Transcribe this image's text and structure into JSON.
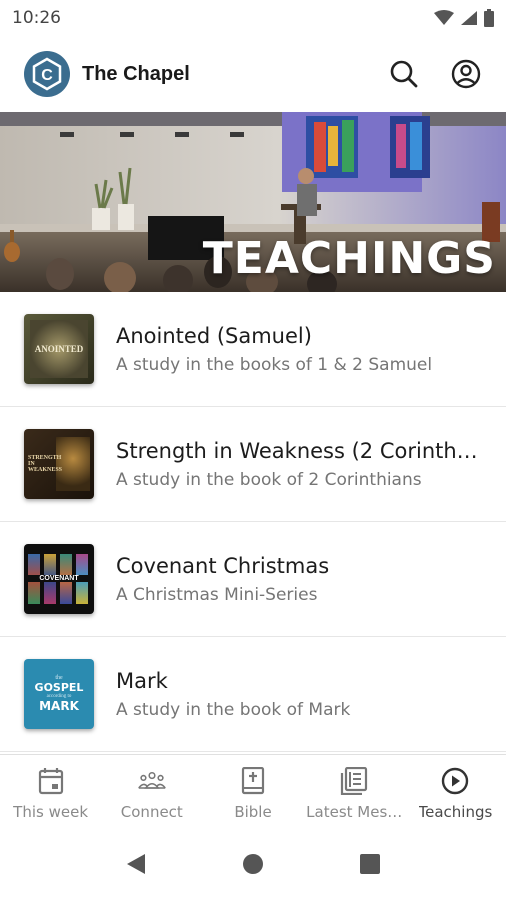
{
  "status": {
    "time": "10:26"
  },
  "app": {
    "title": "The Chapel",
    "logo_letter": "C"
  },
  "hero": {
    "title": "TEACHINGS"
  },
  "items": [
    {
      "title": "Anointed (Samuel)",
      "subtitle": "A study in the books of 1 & 2 Samuel",
      "thumb_text": "ANOINTED"
    },
    {
      "title": "Strength in Weakness (2 Corinthi…",
      "subtitle": "A study in the book of 2 Corinthians",
      "thumb_text": "STRENGTH IN WEAKNESS"
    },
    {
      "title": "Covenant Christmas",
      "subtitle": "A Christmas Mini-Series",
      "thumb_text": "COVENANT"
    },
    {
      "title": "Mark",
      "subtitle": "A study in the book of Mark",
      "thumb_text_1": "the",
      "thumb_text_2": "GOSPEL",
      "thumb_text_3": "according to",
      "thumb_text_4": "MARK"
    }
  ],
  "nav": [
    {
      "label": "This week",
      "icon": "calendar-icon"
    },
    {
      "label": "Connect",
      "icon": "people-icon"
    },
    {
      "label": "Bible",
      "icon": "bible-icon"
    },
    {
      "label": "Latest Mes…",
      "icon": "book-icon"
    },
    {
      "label": "Teachings",
      "icon": "play-circle-icon",
      "active": true
    }
  ],
  "colors": {
    "brand": "#3b6d8f",
    "mark_thumb": "#2b8bb0"
  }
}
